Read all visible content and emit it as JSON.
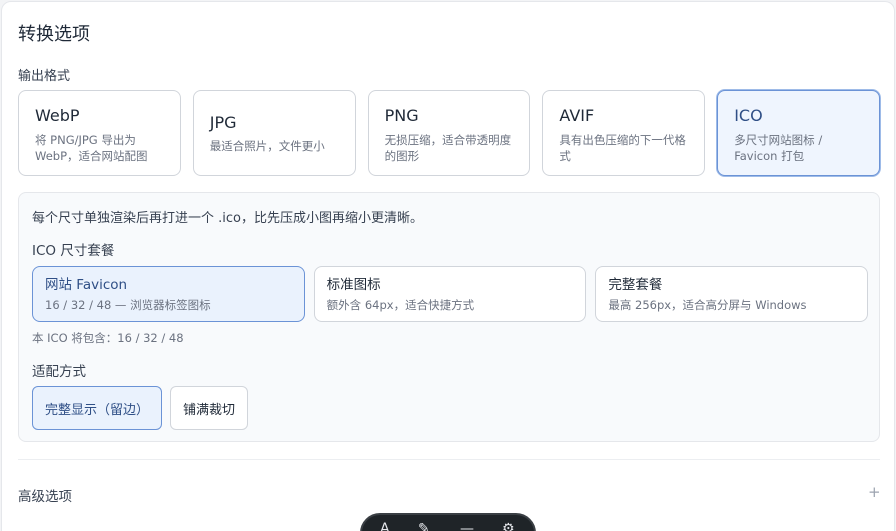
{
  "header": {
    "title": "转换选项"
  },
  "output_format": {
    "label": "输出格式",
    "formats": [
      {
        "name": "WebP",
        "desc": "将 PNG/JPG 导出为 WebP，适合网站配图",
        "selected": false
      },
      {
        "name": "JPG",
        "desc": "最适合照片，文件更小",
        "selected": false
      },
      {
        "name": "PNG",
        "desc": "无损压缩，适合带透明度的图形",
        "selected": false
      },
      {
        "name": "AVIF",
        "desc": "具有出色压缩的下一代格式",
        "selected": false
      },
      {
        "name": "ICO",
        "desc": "多尺寸网站图标 / Favicon 打包",
        "selected": true
      }
    ]
  },
  "ico": {
    "note": "每个尺寸单独渲染后再打进一个 .ico，比先压成小图再缩小更清晰。",
    "size_label": "ICO 尺寸套餐",
    "sizes": [
      {
        "name": "网站 Favicon",
        "desc": "16 / 32 / 48 — 浏览器标签图标",
        "selected": true
      },
      {
        "name": "标准图标",
        "desc": "额外含 64px，适合快捷方式",
        "selected": false
      },
      {
        "name": "完整套餐",
        "desc": "最高 256px，适合高分屏与 Windows",
        "selected": false
      }
    ],
    "contains": "本 ICO 将包含：16 / 32 / 48",
    "fit_label": "适配方式",
    "fit_options": [
      {
        "label": "完整显示（留边）",
        "selected": true
      },
      {
        "label": "铺满裁切",
        "selected": false
      }
    ]
  },
  "advanced": {
    "label": "高级选项",
    "toggle_icon": "plus-icon",
    "toggle_glyph": "+"
  },
  "colors": {
    "accent": "#6b93d6",
    "accent_bg": "#eff5fe",
    "accent_text": "#2f4f86"
  }
}
